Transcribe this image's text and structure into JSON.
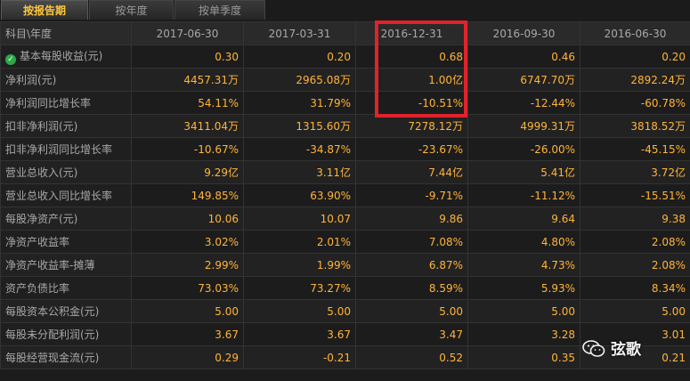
{
  "tabs": [
    {
      "label": "按报告期",
      "active": true
    },
    {
      "label": "按年度",
      "active": false
    },
    {
      "label": "按单季度",
      "active": false
    }
  ],
  "table": {
    "corner_header": "科目\\年度",
    "columns": [
      "2017-06-30",
      "2017-03-31",
      "2016-12-31",
      "2016-09-30",
      "2016-06-30"
    ],
    "rows": [
      {
        "label": "基本每股收益(元)",
        "icon": "check-icon",
        "values": [
          "0.30",
          "0.20",
          "0.68",
          "0.46",
          "0.20"
        ]
      },
      {
        "label": "净利润(元)",
        "values": [
          "4457.31万",
          "2965.08万",
          "1.00亿",
          "6747.70万",
          "2892.24万"
        ]
      },
      {
        "label": "净利润同比增长率",
        "values": [
          "54.11%",
          "31.79%",
          "-10.51%",
          "-12.44%",
          "-60.78%"
        ]
      },
      {
        "label": "扣非净利润(元)",
        "values": [
          "3411.04万",
          "1315.60万",
          "7278.12万",
          "4999.31万",
          "3818.52万"
        ]
      },
      {
        "label": "扣非净利润同比增长率",
        "values": [
          "-10.67%",
          "-34.87%",
          "-23.67%",
          "-26.00%",
          "-45.15%"
        ]
      },
      {
        "label": "营业总收入(元)",
        "values": [
          "9.29亿",
          "3.11亿",
          "7.44亿",
          "5.41亿",
          "3.72亿"
        ]
      },
      {
        "label": "营业总收入同比增长率",
        "values": [
          "149.85%",
          "63.90%",
          "-9.71%",
          "-11.12%",
          "-15.51%"
        ]
      },
      {
        "label": "每股净资产(元)",
        "values": [
          "10.06",
          "10.07",
          "9.86",
          "9.64",
          "9.38"
        ]
      },
      {
        "label": "净资产收益率",
        "values": [
          "3.02%",
          "2.01%",
          "7.08%",
          "4.80%",
          "2.08%"
        ]
      },
      {
        "label": "净资产收益率-摊薄",
        "values": [
          "2.99%",
          "1.99%",
          "6.87%",
          "4.73%",
          "2.08%"
        ]
      },
      {
        "label": "资产负债比率",
        "values": [
          "73.03%",
          "73.27%",
          "8.59%",
          "5.93%",
          "8.34%"
        ]
      },
      {
        "label": "每股资本公积金(元)",
        "values": [
          "5.00",
          "5.00",
          "5.00",
          "5.00",
          "5.00"
        ]
      },
      {
        "label": "每股未分配利润(元)",
        "values": [
          "3.67",
          "3.67",
          "3.47",
          "3.28",
          "3.01"
        ]
      },
      {
        "label": "每股经营现金流(元)",
        "values": [
          "0.29",
          "-0.21",
          "0.52",
          "0.35",
          "0.21"
        ]
      }
    ]
  },
  "highlight_color": "#e0232b",
  "watermark": {
    "text": "弦歌",
    "icon": "wechat-icon"
  }
}
